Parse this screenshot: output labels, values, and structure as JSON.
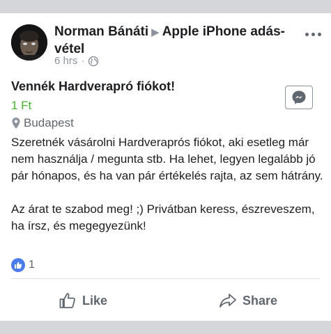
{
  "post": {
    "author": "Norman Bánáti",
    "group": "Apple iPhone adás-vétel",
    "time": "6 hrs",
    "separator": "·",
    "item_title": "Vennék Hardverapró fiókot!",
    "price": "1 Ft",
    "location": "Budapest",
    "body_paragraph_1": "Szeretnék vásárolni Hardveraprós fiókot, aki esetleg már nem használja / megunta stb. Ha lehet, legyen legalább jó pár hónapos, és ha van pár értékelés rajta, az sem hátrány.",
    "body_paragraph_2": "Az árat te szabod meg! ;) Privátban keress, észreveszem, ha írsz, és megegyezünk!",
    "reaction_count": "1"
  },
  "actions": {
    "like_label": "Like",
    "share_label": "Share"
  },
  "icons": {
    "more": "more-options-icon",
    "privacy": "globe-icon",
    "location": "map-pin-icon",
    "messenger": "messenger-icon",
    "reaction": "thumbs-up-icon"
  },
  "colors": {
    "price": "#42b72a",
    "reaction_badge": "#4a7bf0",
    "band": "#d4d6da"
  }
}
